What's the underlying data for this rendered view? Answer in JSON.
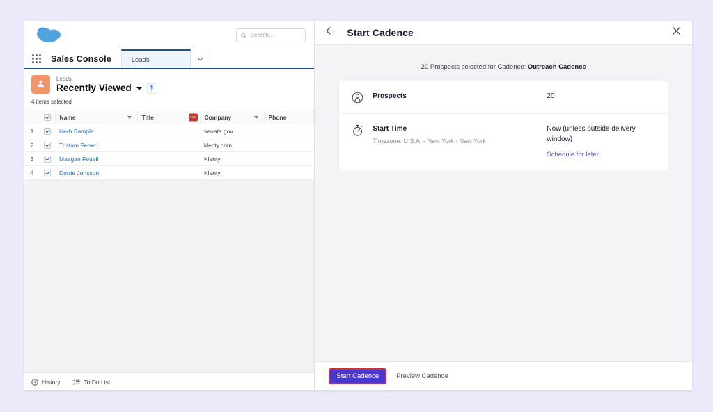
{
  "salesforce": {
    "search": {
      "placeholder": "Search..."
    },
    "nav": {
      "app_name": "Sales Console",
      "tab_label": "Leads"
    },
    "list_header": {
      "object_label": "Leads",
      "view_name": "Recently Viewed",
      "selection_count": "4 items selected"
    },
    "table": {
      "columns": [
        "Name",
        "Title",
        "Company",
        "Phone"
      ],
      "rows": [
        {
          "index": "1",
          "name": "Herb Sample",
          "title": "",
          "company": "senate.gov",
          "phone": ""
        },
        {
          "index": "2",
          "name": "Tristam Ferreri",
          "title": "",
          "company": "klenty.com",
          "phone": ""
        },
        {
          "index": "3",
          "name": "Maegan Feuell",
          "title": "",
          "company": "Klenty",
          "phone": ""
        },
        {
          "index": "4",
          "name": "Dorrie Jonsson",
          "title": "",
          "company": "Klenty",
          "phone": ""
        }
      ]
    },
    "footer": {
      "history": "History",
      "todo": "To Do List"
    }
  },
  "panel": {
    "title": "Start Cadence",
    "subtitle_prefix": "20 Prospects selected for Cadence: ",
    "cadence_name": "Outreach Cadence",
    "rows": [
      {
        "label": "Prospects",
        "sub": "",
        "value": "20",
        "link": ""
      },
      {
        "label": "Start Time",
        "sub": "Timezone: U.S.A. - New York - New York",
        "value": "Now (unless outside delivery window)",
        "link": "Schedule for later"
      }
    ],
    "footer": {
      "primary": "Start Cadence",
      "secondary": "Preview Cadence"
    }
  },
  "colors": {
    "page_background": "#ebeafb",
    "brand_blue": "#1b5297",
    "accent_purple": "#4b37c9",
    "link_purple": "#5c5ccc",
    "leads_icon": "#f2956a",
    "badge_red": "#c23934",
    "highlight_red": "#d32f2f"
  }
}
